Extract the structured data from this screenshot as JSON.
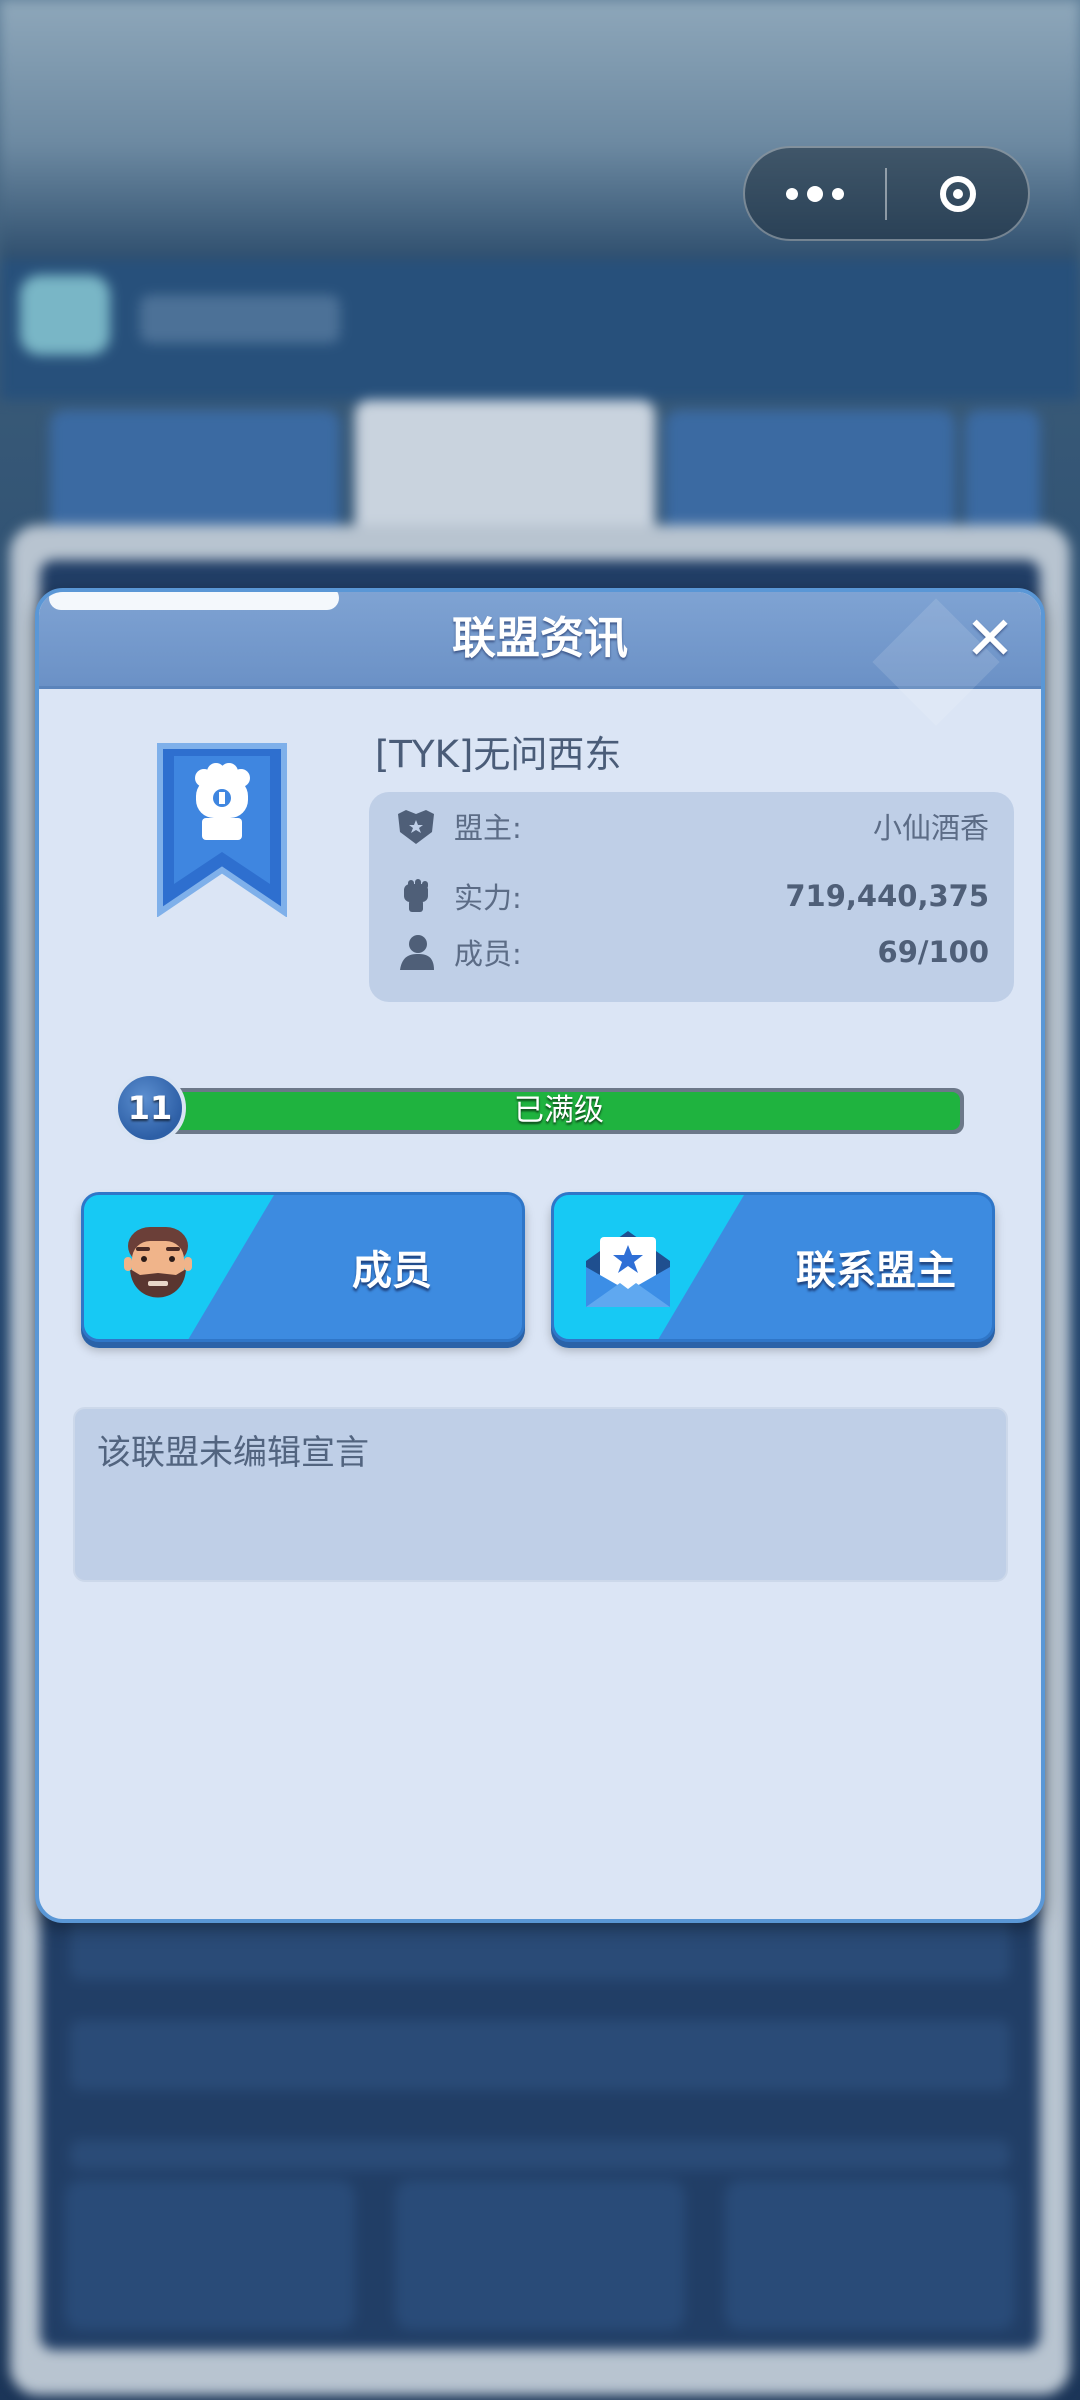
{
  "capsule": {
    "more_icon": "more-dots-icon",
    "close_icon": "target-close-icon"
  },
  "modal": {
    "title": "联盟资讯",
    "close_label": "✕"
  },
  "alliance": {
    "name": "[TYK]无问西东",
    "badge_icon": "gauntlet-banner-icon",
    "info": [
      {
        "label": "盟主:",
        "value": "小仙酒香",
        "icon": "leader-shield-icon"
      },
      {
        "label": "实力:",
        "value": "719,440,375",
        "icon": "fist-icon"
      },
      {
        "label": "成员:",
        "value": "69/100",
        "icon": "person-icon"
      }
    ]
  },
  "level": {
    "number": "11",
    "status_text": "已满级",
    "progress_percent": 100
  },
  "buttons": {
    "members_label": "成员",
    "contact_label": "联系盟主"
  },
  "declaration": {
    "text": "该联盟未编辑宣言"
  },
  "colors": {
    "accent_blue": "#3d8be0",
    "cyan": "#17c9f4",
    "progress_green": "#1fb33f",
    "modal_bg": "#dbe5f5"
  }
}
